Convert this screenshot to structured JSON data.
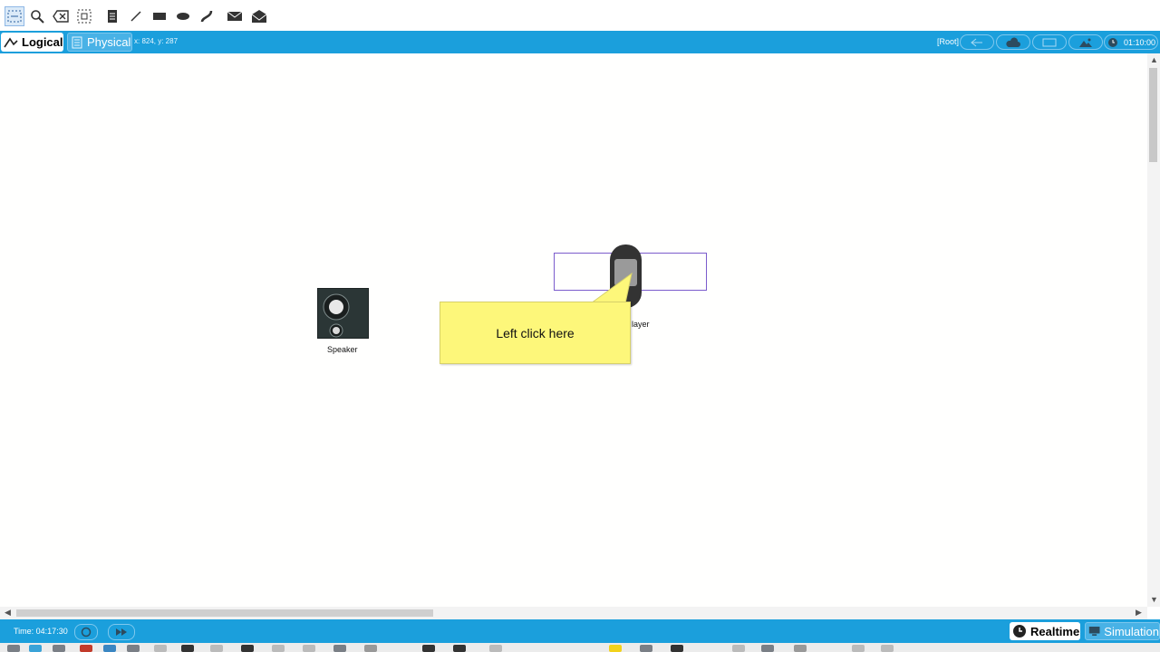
{
  "toolbar": {
    "icons": [
      "select-icon",
      "inspect-icon",
      "delete-icon",
      "resize-icon",
      "note-icon",
      "line-icon",
      "rectangle-icon",
      "ellipse-icon",
      "freeform-icon",
      "simple-pdu-icon",
      "complex-pdu-icon"
    ]
  },
  "workspace_bar": {
    "logical_label": "Logical",
    "physical_label": "Physical",
    "coords": "x: 824, y: 287",
    "root_label": "[Root]",
    "clock": "01:10:00"
  },
  "canvas": {
    "devices": [
      {
        "name": "speaker",
        "label": "Speaker"
      },
      {
        "name": "player",
        "label": "layer"
      }
    ],
    "callout_text": "Left click here"
  },
  "statusbar": {
    "time": "Time: 04:17:30",
    "realtime_label": "Realtime",
    "simulation_label": "Simulation"
  },
  "colors": {
    "accent": "#1b9fdc",
    "callout": "#fdf77a",
    "selection": "#7b5ccc"
  }
}
